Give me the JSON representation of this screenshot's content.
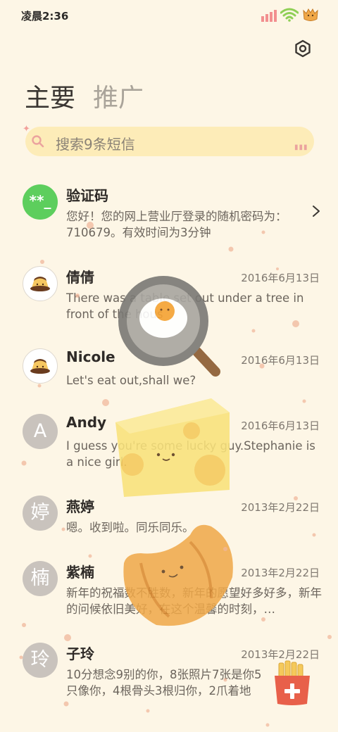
{
  "status_bar": {
    "time": "凌晨2:36",
    "colors": {
      "signal": "#f28f8f",
      "wifi": "#8fcf55",
      "battery": "#f0a848"
    }
  },
  "header": {
    "settings_icon": "gear-icon",
    "tabs": [
      {
        "label": "主要",
        "active": true
      },
      {
        "label": "推广",
        "active": false
      }
    ]
  },
  "search": {
    "placeholder": "搜索9条短信",
    "icon": "search-icon",
    "decoration": "▮▮▮"
  },
  "messages": [
    {
      "name": "验证码",
      "date": "",
      "avatar_type": "code",
      "avatar_text": "**_",
      "preview": "您好！您的网上营业厅登录的随机密码为：710679。有效时间为3分钟",
      "has_chevron": true
    },
    {
      "name": "倩倩",
      "date": "2016年6月13日",
      "avatar_type": "pudding",
      "avatar_text": "",
      "preview": "There was a table set out under a tree in front of the hous"
    },
    {
      "name": "Nicole",
      "date": "2016年6月13日",
      "avatar_type": "pudding",
      "avatar_text": "",
      "preview": "Let's eat out,shall we?"
    },
    {
      "name": "Andy",
      "date": "2016年6月13日",
      "avatar_type": "letter",
      "avatar_text": "A",
      "preview": "I guess you're some lucky guy.Stephanie is a nice girl."
    },
    {
      "name": "燕婷",
      "date": "2013年2月22日",
      "avatar_type": "letter",
      "avatar_text": "婷",
      "preview": "嗯。收到啦。同乐同乐。"
    },
    {
      "name": "紫楠",
      "date": "2013年2月22日",
      "avatar_type": "letter",
      "avatar_text": "楠",
      "preview": "新年的祝福数不胜数，新年的愿望好多好多，新年的问候依旧美好，在这个温馨的时刻，…"
    },
    {
      "name": "子玲",
      "date": "2013年2月22日",
      "avatar_type": "letter",
      "avatar_text": "玲",
      "preview": "10分想念9别的你，8张照片7张是你5只像你，4根骨头3根归你，2爪着地"
    }
  ],
  "fab": {
    "icon": "compose-icon",
    "color": "#e8604a"
  },
  "theme": {
    "background": "#fdf6e6",
    "search_bg": "#fdecb8",
    "accent": "#5dce5d"
  }
}
